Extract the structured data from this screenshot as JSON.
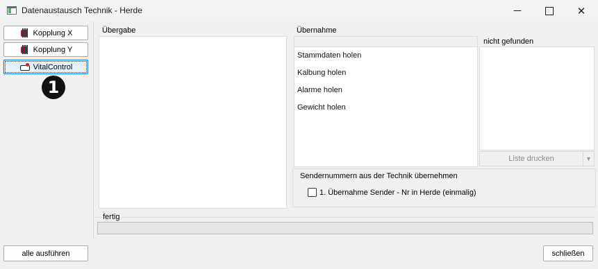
{
  "window": {
    "title": "Datenaustausch Technik - Herde",
    "minimize": "─",
    "close": "✕"
  },
  "sidebar": {
    "items": [
      {
        "label": "Kopplung X",
        "icon": "plug-icon"
      },
      {
        "label": "Kopplung Y",
        "icon": "plug-icon"
      },
      {
        "label": "VitalControl",
        "icon": "cow-icon",
        "active": true
      }
    ],
    "badge": "1"
  },
  "uebergabe": {
    "label": "Übergabe"
  },
  "uebernahme": {
    "label": "Übernahme",
    "items": [
      "Stammdaten holen",
      "Kalbung holen",
      "Alarme holen",
      "Gewicht holen"
    ]
  },
  "nicht_gefunden": {
    "label": "nicht gefunden",
    "print_button": "Liste drucken",
    "dropdown_arrow": "▼"
  },
  "sender": {
    "group_label": "Sendernummern aus der Technik übernehmen",
    "checkbox_label": "1. Übernahme Sender - Nr in Herde (einmalig)",
    "checked": false
  },
  "status": {
    "label": "fertig",
    "progress": 0
  },
  "footer": {
    "run_all": "alle ausführen",
    "close": "schließen"
  },
  "colors": {
    "accent": "#0078d7",
    "background": "#f0f0f0",
    "panel_white": "#ffffff"
  }
}
